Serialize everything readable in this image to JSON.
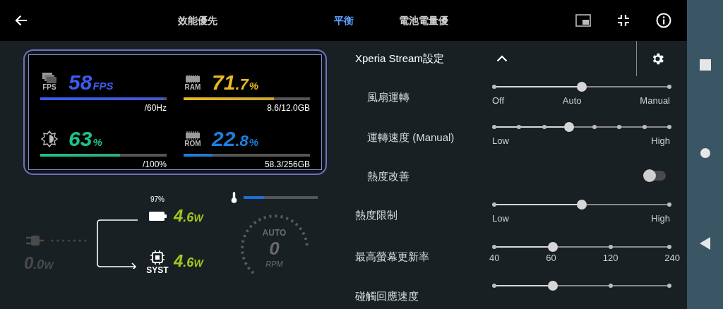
{
  "top_bar": {
    "tabs": [
      {
        "label": "效能優先",
        "selected": false
      },
      {
        "label": "平衡",
        "selected": true
      },
      {
        "label": "電池電量優",
        "selected": false
      }
    ]
  },
  "monitor": {
    "stats": [
      {
        "kind": "fps",
        "label": "FPS",
        "value": "58",
        "unit": "FPS",
        "level": 0.98,
        "detail": "/60Hz",
        "color": "#3b5bef"
      },
      {
        "kind": "ram",
        "label": "RAM",
        "value": "71",
        "fraction": ".7",
        "unit": "%",
        "level": 0.717,
        "detail": "8.6/12.0GB",
        "color": "#e8b923"
      },
      {
        "kind": "brightness",
        "value": "63",
        "unit": "%",
        "level": 0.63,
        "detail": "/100%",
        "color": "#1fc18a"
      },
      {
        "kind": "rom",
        "label": "ROM",
        "value": "22",
        "fraction": ".8",
        "unit": "%",
        "level": 0.228,
        "detail": "58.3/256GB",
        "color": "#1a7fe0"
      }
    ]
  },
  "power": {
    "input": {
      "value": "0",
      "fraction": ".0",
      "unit": "W"
    },
    "battery": {
      "percent": "97%",
      "value": "4",
      "fraction": ".6",
      "unit": "W"
    },
    "system": {
      "label": "SYST",
      "value": "4",
      "fraction": ".6",
      "unit": "W"
    },
    "temperature": {
      "level": 0.28
    },
    "fan": {
      "mode": "AUTO",
      "value": "0",
      "unit": "RPM"
    }
  },
  "settings": {
    "title": "Xperia Stream設定",
    "expanded": true,
    "rows": [
      {
        "kind": "slider",
        "label": "風扇運轉",
        "indented": true,
        "level": 0.5,
        "labels": [
          "Off",
          "Auto",
          "Manual"
        ]
      },
      {
        "kind": "slider",
        "label": "運轉速度 (Manual)",
        "indented": true,
        "level": 0.4286,
        "labels": [
          "Low",
          "High"
        ]
      },
      {
        "kind": "toggle",
        "label": "熱度改善",
        "indented": true,
        "on": false
      },
      {
        "kind": "slider",
        "label": "熱度限制",
        "indented": false,
        "level": 0.5,
        "labels": [
          "Low",
          "High"
        ]
      },
      {
        "kind": "slider",
        "label": "最高螢幕更新率",
        "indented": false,
        "level": 0.3333,
        "labels": [
          "40",
          "60",
          "120",
          "240"
        ]
      },
      {
        "kind": "slider",
        "label": "碰觸回應速度",
        "indented": false,
        "level": 0.3333
      }
    ]
  }
}
